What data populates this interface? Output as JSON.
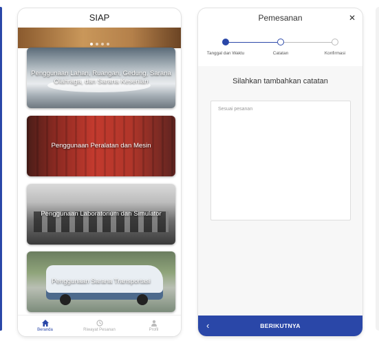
{
  "app": {
    "title": "SIAP",
    "categories": [
      {
        "label": "Penggunaan Lahan, Ruangan, Gedung, Sarana Olahraga, dan Sarana Kesenian"
      },
      {
        "label": "Penggunaan Peralatan dan Mesin"
      },
      {
        "label": "Penggunaan Laboratorium dan Simulator"
      },
      {
        "label": "Penggunaan Sarana Transportasi"
      }
    ],
    "nav": [
      {
        "label": "Beranda",
        "icon": "home-icon"
      },
      {
        "label": "Riwayat Pesanan",
        "icon": "history-icon"
      },
      {
        "label": "Profil",
        "icon": "person-icon"
      }
    ]
  },
  "order": {
    "title": "Pemesanan",
    "close_icon": "close-icon",
    "steps": [
      {
        "label": "Tanggal dan Waktu",
        "state": "done"
      },
      {
        "label": "Catatan",
        "state": "current"
      },
      {
        "label": "Konfirmasi",
        "state": "todo"
      }
    ],
    "prompt": "Silahkan tambahkan catatan",
    "notes_placeholder": "Sesuai pesanan",
    "next_label": "BERIKUTNYA",
    "back_icon": "chevron-left-icon"
  },
  "colors": {
    "primary": "#2a47a8",
    "step_todo": "#bbbbbb"
  }
}
